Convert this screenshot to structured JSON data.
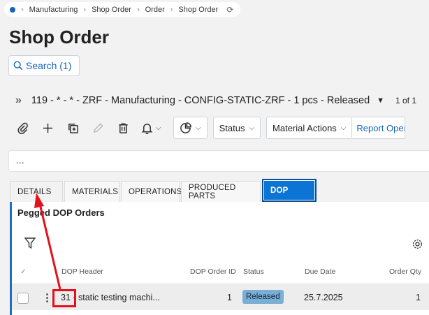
{
  "breadcrumb": [
    "Manufacturing",
    "Shop Order",
    "Order",
    "Shop Order"
  ],
  "page_title": "Shop Order",
  "search": {
    "label": "Search (1)"
  },
  "record": {
    "title": "119 - * - * - ZRF - Manufacturing - CONFIG-STATIC-ZRF - 1 pcs - Released",
    "pager": "1 of 1"
  },
  "toolbar": {
    "status_label": "Status",
    "material_actions_label": "Material Actions",
    "report_oper_label": "Report Oper"
  },
  "ellipsis": "...",
  "tabs": [
    "DETAILS",
    "MATERIALS",
    "OPERATIONS",
    "PRODUCED PARTS",
    "DOP"
  ],
  "panel": {
    "title": "Pegged DOP Orders",
    "columns": [
      "DOP Header",
      "DOP Order ID",
      "Status",
      "Due Date",
      "Order Qty"
    ],
    "rows": [
      {
        "dop_header": "31 - static testing machi...",
        "dop_order_id": "1",
        "status": "Released",
        "due_date": "25.7.2025",
        "order_qty": "1"
      }
    ]
  },
  "colors": {
    "accent": "#0b74d4",
    "status_badge": "#7aaed5",
    "annotation": "#e3111b"
  }
}
